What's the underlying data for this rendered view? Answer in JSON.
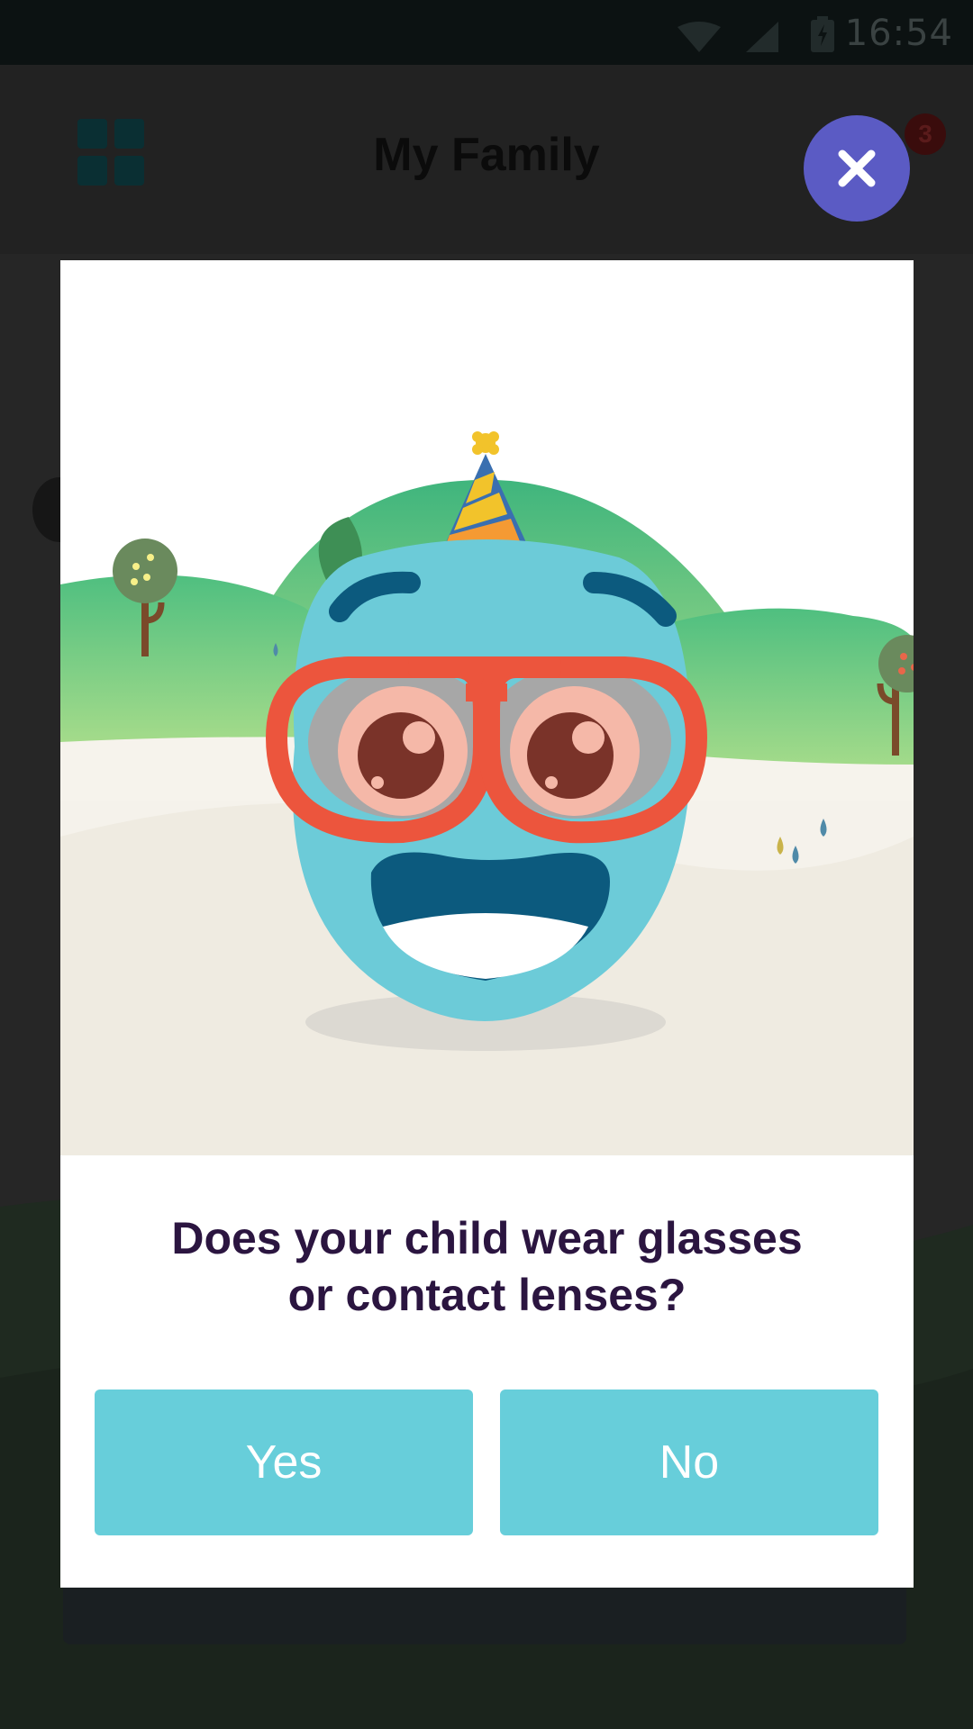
{
  "status_bar": {
    "time": "16:54",
    "icons": [
      "wifi-icon",
      "signal-icon",
      "battery-charging-icon"
    ]
  },
  "app": {
    "title": "My Family",
    "menu_icon": "grid-icon",
    "notification_count": "3"
  },
  "dialog": {
    "close_icon": "close-icon",
    "illustration": "blue-emoji-with-glasses-and-party-hat",
    "question_line1": "Does your child wear glasses",
    "question_line2": "or contact lenses?",
    "yes_label": "Yes",
    "no_label": "No"
  },
  "colors": {
    "accent": "#67ceda",
    "close_button": "#5b5bc4",
    "question_text": "#2b1540",
    "face": "#6ccbd8",
    "glasses": "#ec553d"
  }
}
